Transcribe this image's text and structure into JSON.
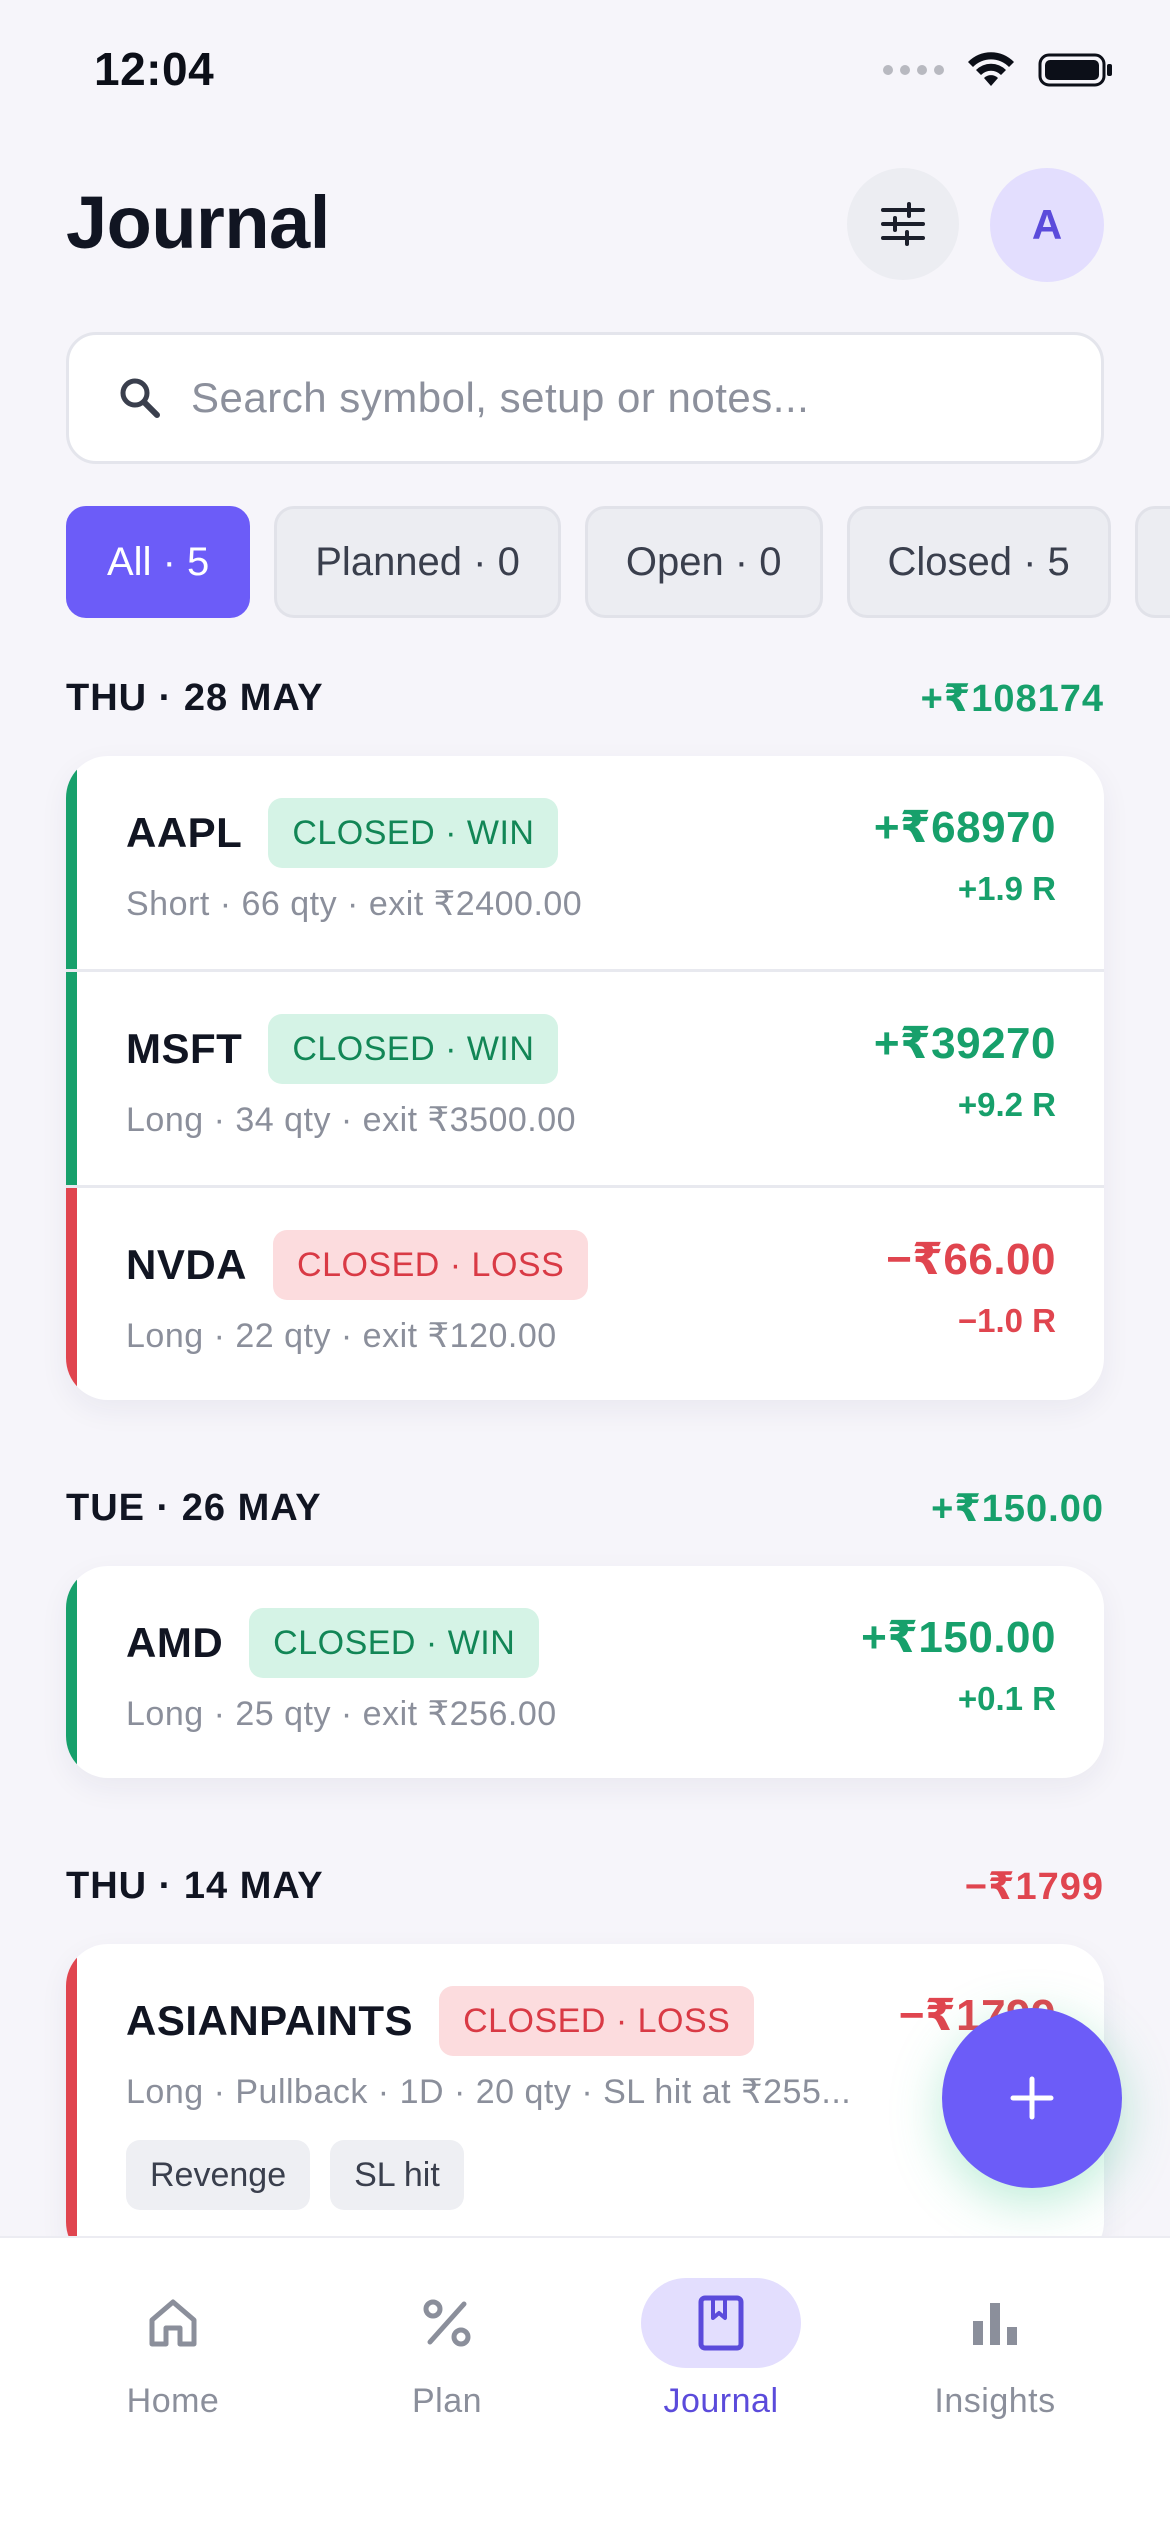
{
  "status_bar": {
    "time": "12:04"
  },
  "header": {
    "title": "Journal",
    "avatar_letter": "A"
  },
  "search": {
    "placeholder": "Search symbol, setup or notes..."
  },
  "filters": [
    {
      "label": "All · 5",
      "active": true
    },
    {
      "label": "Planned · 0",
      "active": false
    },
    {
      "label": "Open · 0",
      "active": false
    },
    {
      "label": "Closed · 5",
      "active": false
    }
  ],
  "days": [
    {
      "date": "THU · 28 MAY",
      "total": "+₹108174",
      "trades": [
        {
          "symbol": "AAPL",
          "status": "CLOSED · WIN",
          "meta": "Short · 66 qty · exit ₹2400.00",
          "pnl": "+₹68970",
          "r": "+1.9 R"
        },
        {
          "symbol": "MSFT",
          "status": "CLOSED · WIN",
          "meta": "Long · 34 qty · exit ₹3500.00",
          "pnl": "+₹39270",
          "r": "+9.2 R"
        },
        {
          "symbol": "NVDA",
          "status": "CLOSED · LOSS",
          "meta": "Long · 22 qty · exit ₹120.00",
          "pnl": "−₹66.00",
          "r": "−1.0 R"
        }
      ]
    },
    {
      "date": "TUE · 26 MAY",
      "total": "+₹150.00",
      "trades": [
        {
          "symbol": "AMD",
          "status": "CLOSED · WIN",
          "meta": "Long · 25 qty · exit ₹256.00",
          "pnl": "+₹150.00",
          "r": "+0.1 R"
        }
      ]
    },
    {
      "date": "THU · 14 MAY",
      "total": "−₹1799",
      "trades": [
        {
          "symbol": "ASIANPAINTS",
          "status": "CLOSED · LOSS",
          "meta": "Long · Pullback · 1D · 20 qty · SL hit at ₹255...",
          "pnl": "−₹1799",
          "tags": [
            "Revenge",
            "SL hit"
          ]
        }
      ]
    }
  ],
  "bottom_nav": [
    {
      "label": "Home",
      "icon": "home-icon"
    },
    {
      "label": "Plan",
      "icon": "percent-icon"
    },
    {
      "label": "Journal",
      "icon": "journal-icon",
      "active": true
    },
    {
      "label": "Insights",
      "icon": "bar-chart-icon"
    }
  ],
  "colors": {
    "accent": "#6c5cf8",
    "win": "#17a06b",
    "loss": "#e0454f",
    "background": "#f6f5fa"
  }
}
